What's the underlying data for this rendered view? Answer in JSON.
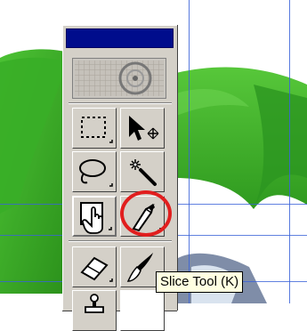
{
  "tooltip": {
    "text": "Slice Tool (K)"
  },
  "tools": [
    {
      "name": "marquee-tool",
      "icon": "rectangular-marquee-icon"
    },
    {
      "name": "move-tool",
      "icon": "move-arrow-icon"
    },
    {
      "name": "lasso-tool",
      "icon": "lasso-icon"
    },
    {
      "name": "magic-wand-tool",
      "icon": "magic-wand-icon"
    },
    {
      "name": "crop-tool",
      "icon": "crop-icon"
    },
    {
      "name": "slice-tool",
      "icon": "slice-knife-icon",
      "highlighted": true
    },
    {
      "name": "eraser-tool",
      "icon": "eraser-icon"
    },
    {
      "name": "brush-tool",
      "icon": "brush-icon"
    },
    {
      "name": "stamp-tool",
      "icon": "stamp-icon"
    }
  ],
  "colors": {
    "titlebar": "#000c8c",
    "palette": "#d4d0c8",
    "highlight_ring": "#e11e1e",
    "guides": "#3b63d8",
    "green_shape": "#3fb52b",
    "tooltip_bg": "#ffffe1"
  }
}
